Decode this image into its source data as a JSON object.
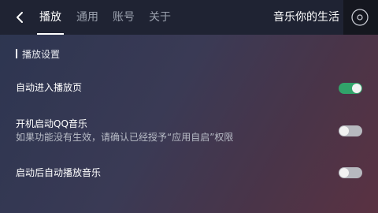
{
  "header": {
    "tabs": [
      {
        "label": "播放",
        "active": true
      },
      {
        "label": "通用",
        "active": false
      },
      {
        "label": "账号",
        "active": false
      },
      {
        "label": "关于",
        "active": false
      }
    ],
    "brand": "音乐你的生活",
    "back_icon": "chevron-left-icon",
    "disc_icon": "disc-icon"
  },
  "section": {
    "title": "播放设置"
  },
  "settings": [
    {
      "label": "自动进入播放页",
      "sub": "",
      "enabled": true
    },
    {
      "label": "开机启动QQ音乐",
      "sub": "如果功能没有生效，请确认已经授予“应用自启”权限",
      "enabled": false
    },
    {
      "label": "启动后自动播放音乐",
      "sub": "",
      "enabled": false
    }
  ],
  "colors": {
    "switch_on": "#31a46a",
    "switch_off": "#b7b9bf",
    "topbar": "#1f2333"
  }
}
